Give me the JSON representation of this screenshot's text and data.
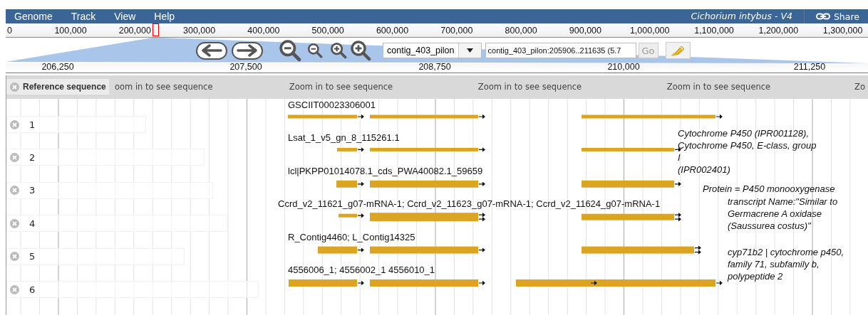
{
  "menu": [
    {
      "label": "Genome"
    },
    {
      "label": "Track"
    },
    {
      "label": "View"
    },
    {
      "label": "Help"
    }
  ],
  "dataset_title": "Cichorium intybus - V4",
  "share": {
    "label": "Share"
  },
  "overview_ruler": {
    "labels": [
      "0",
      "100,000",
      "200,000",
      "300,000",
      "400,000",
      "500,000",
      "600,000",
      "700,000",
      "800,000",
      "900,000",
      "1,000,000",
      "1,100,000",
      "1,200,000",
      "1,300,000"
    ]
  },
  "navigation": {
    "reference_dropdown": {
      "value": "contig_403_pilon"
    },
    "location_field": {
      "value": "contig_403_pilon:205906..211635 (5.7"
    },
    "go_button": {
      "label": "Go"
    }
  },
  "detail_ruler": {
    "labels": [
      "206,250",
      "207,500",
      "208,750",
      "210,000",
      "211,250"
    ]
  },
  "reference_track": {
    "label": "Reference sequence",
    "blocks": [
      "oom in to see sequence",
      "Zoom in to see sequence",
      "Zoom in to see sequence",
      "Zoom in to see sequence",
      "Zo"
    ]
  },
  "tracks": [
    {
      "label": "1",
      "feature_name": "GSCIIT00023306001"
    },
    {
      "label": "2",
      "feature_name": "Lsat_1_v5_gn_8_115261.1",
      "description": "Cytochrome P450 (IPR001128),\nCytochrome P450, E-class, group\nI\n(IPR002401)"
    },
    {
      "label": "3",
      "feature_name": "lcl|PKPP01014078.1_cds_PWA40082.1_59659",
      "description": "Protein = P450 monooxygenase"
    },
    {
      "label": "4",
      "feature_name": "Ccrd_v2_11621_g07-mRNA-1; Ccrd_v2_11623_g07-mRNA-1; Ccrd_v2_11624_g07-mRNA-1",
      "description": "transcript Name:\"Similar to\nGermacrene A oxidase\n(Saussurea costus)\""
    },
    {
      "label": "5",
      "feature_name": "R_Contig4460;  L_Contig14325",
      "description": "cyp71b2 | cytochrome p450,\nfamily 71, subfamily b,\npolypeptide 2"
    },
    {
      "label": "6",
      "feature_name": "4556006_1; 4556002_1 4556010_1"
    }
  ]
}
